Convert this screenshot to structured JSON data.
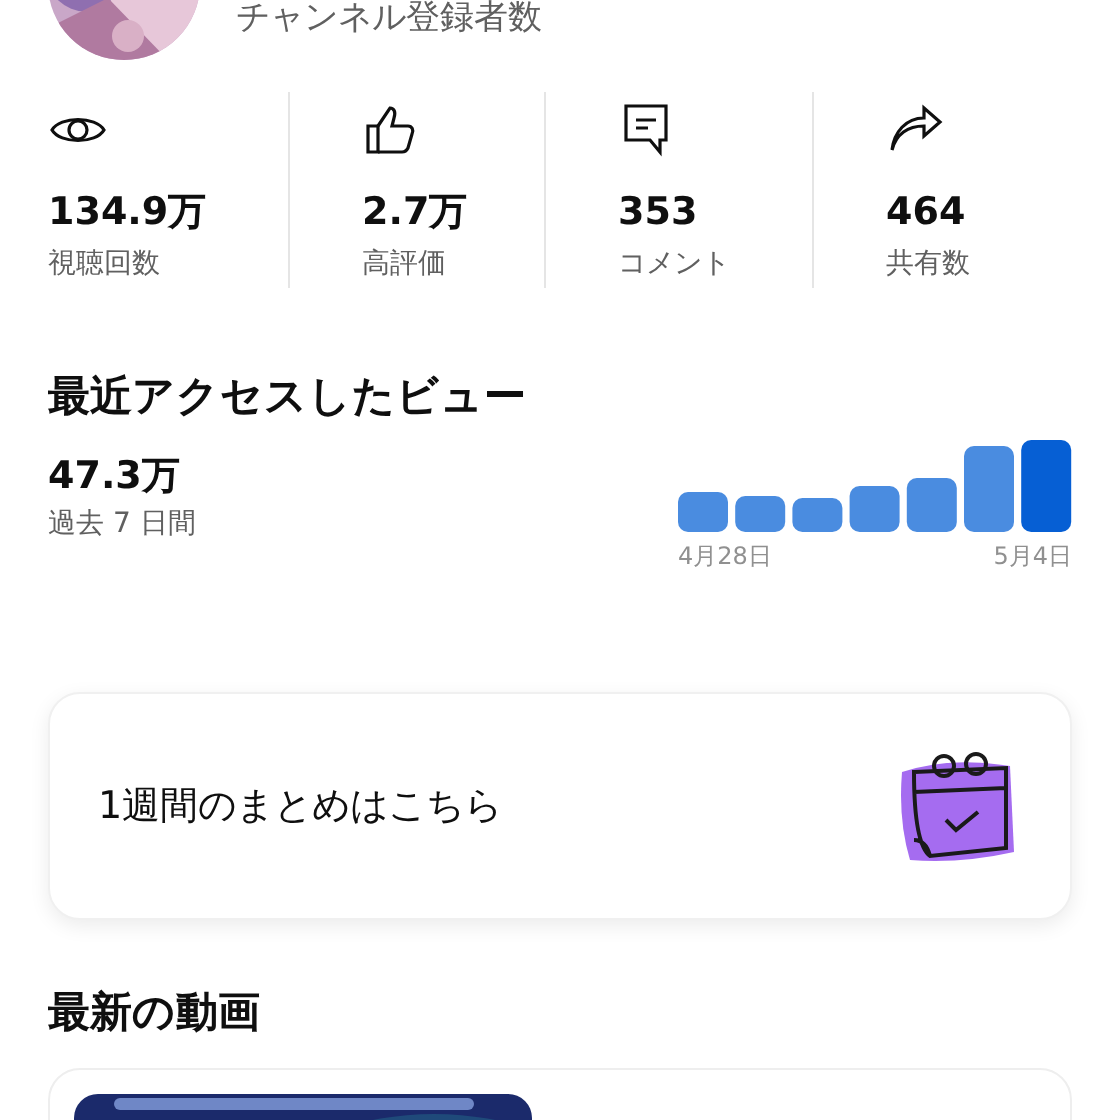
{
  "channel": {
    "subscribers_label": "チャンネル登録者数"
  },
  "stats": [
    {
      "kind": "views",
      "value": "134.9万",
      "label": "視聴回数"
    },
    {
      "kind": "likes",
      "value": "2.7万",
      "label": "高評価"
    },
    {
      "kind": "comments",
      "value": "353",
      "label": "コメント"
    },
    {
      "kind": "shares",
      "value": "464",
      "label": "共有数"
    }
  ],
  "recent_views": {
    "title": "最近アクセスしたビュー",
    "total": "47.3万",
    "period": "過去 7 日間",
    "start_label": "4月28日",
    "end_label": "5月4日"
  },
  "weekly_summary": {
    "text": "1週間のまとめはこちら"
  },
  "latest_videos": {
    "title": "最新の動画"
  }
}
